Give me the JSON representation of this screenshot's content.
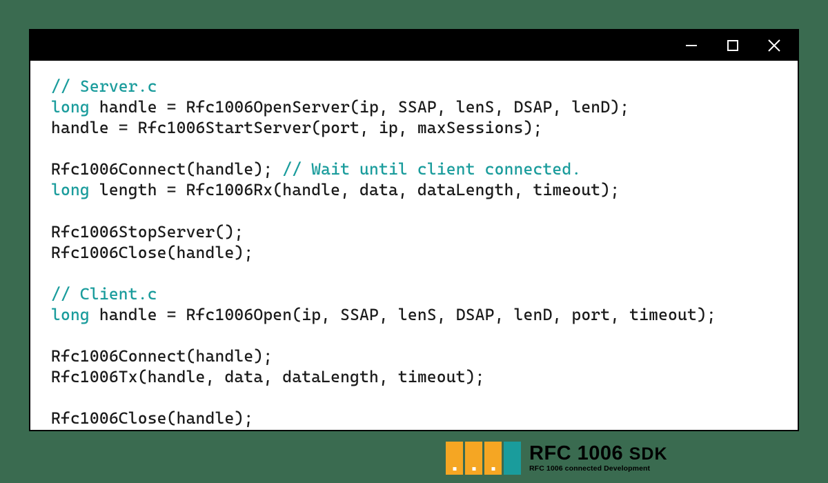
{
  "window": {
    "controls": {
      "minimize": "minimize",
      "maximize": "maximize",
      "close": "close"
    }
  },
  "code": {
    "lines": [
      {
        "segments": [
          {
            "cls": "comment",
            "text": "// Server.c"
          }
        ]
      },
      {
        "segments": [
          {
            "cls": "keyword",
            "text": "long"
          },
          {
            "cls": "",
            "text": " handle = Rfc1006OpenServer(ip, SSAP, lenS, DSAP, lenD);"
          }
        ]
      },
      {
        "segments": [
          {
            "cls": "",
            "text": "handle = Rfc1006StartServer(port, ip, maxSessions);"
          }
        ]
      },
      {
        "segments": [
          {
            "cls": "",
            "text": ""
          }
        ]
      },
      {
        "segments": [
          {
            "cls": "",
            "text": "Rfc1006Connect(handle); "
          },
          {
            "cls": "comment",
            "text": "// Wait until client connected."
          }
        ]
      },
      {
        "segments": [
          {
            "cls": "keyword",
            "text": "long"
          },
          {
            "cls": "",
            "text": " length = Rfc1006Rx(handle, data, dataLength, timeout);"
          }
        ]
      },
      {
        "segments": [
          {
            "cls": "",
            "text": ""
          }
        ]
      },
      {
        "segments": [
          {
            "cls": "",
            "text": "Rfc1006StopServer();"
          }
        ]
      },
      {
        "segments": [
          {
            "cls": "",
            "text": "Rfc1006Close(handle);"
          }
        ]
      },
      {
        "segments": [
          {
            "cls": "",
            "text": ""
          }
        ]
      },
      {
        "segments": [
          {
            "cls": "comment",
            "text": "// Client.c"
          }
        ]
      },
      {
        "segments": [
          {
            "cls": "keyword",
            "text": "long"
          },
          {
            "cls": "",
            "text": " handle = Rfc1006Open(ip, SSAP, lenS, DSAP, lenD, port, timeout);"
          }
        ]
      },
      {
        "segments": [
          {
            "cls": "",
            "text": ""
          }
        ]
      },
      {
        "segments": [
          {
            "cls": "",
            "text": "Rfc1006Connect(handle);"
          }
        ]
      },
      {
        "segments": [
          {
            "cls": "",
            "text": "Rfc1006Tx(handle, data, dataLength, timeout);"
          }
        ]
      },
      {
        "segments": [
          {
            "cls": "",
            "text": ""
          }
        ]
      },
      {
        "segments": [
          {
            "cls": "",
            "text": "Rfc1006Close(handle);"
          }
        ]
      }
    ]
  },
  "logo": {
    "title_main": "RFC 1006 ",
    "title_sdk": "SDK",
    "subtitle": "RFC 1006 connected Development"
  }
}
